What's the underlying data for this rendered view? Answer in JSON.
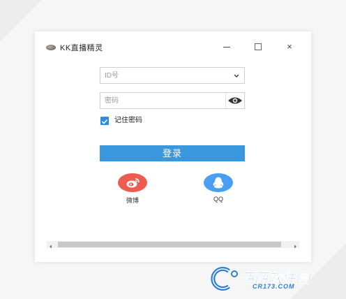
{
  "window": {
    "title": "KK直播精灵",
    "controls": {
      "minimize": "minimize",
      "maximize": "maximize",
      "close": "×"
    }
  },
  "login": {
    "id_placeholder": "ID号",
    "password_placeholder": "密码",
    "id_value": "",
    "password_value": "",
    "remember_label": "记住密码",
    "remember_checked": true,
    "submit_label": "登录"
  },
  "social": [
    {
      "name": "weibo",
      "label": "微博",
      "icon": "weibo-icon",
      "color": "#ee5c50"
    },
    {
      "name": "qq",
      "label": "QQ",
      "icon": "qq-penguin-icon",
      "color": "#4a9ff5"
    }
  ],
  "colors": {
    "accent": "#3a96dd",
    "checkbox": "#2f8de4"
  },
  "watermark": {
    "name": "西西软件园",
    "url": "CR173.COM"
  }
}
